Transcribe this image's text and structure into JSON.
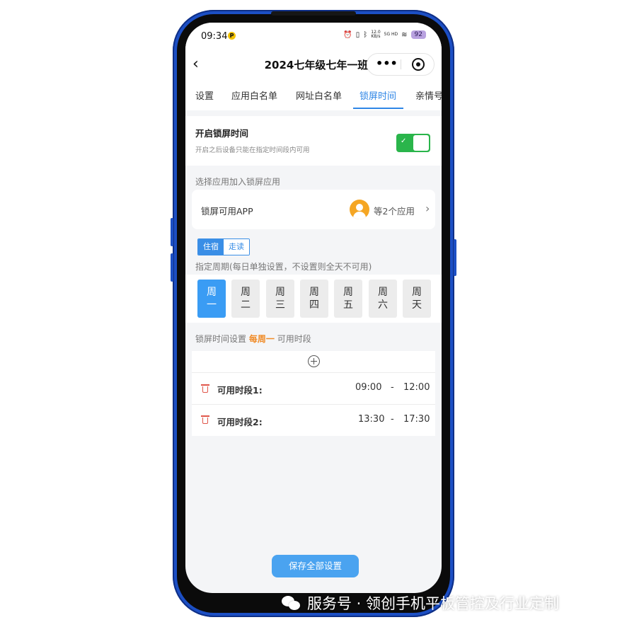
{
  "status_bar": {
    "time": "09:34",
    "badge": "P",
    "net_speed_value": "12.0",
    "net_speed_unit": "KB/s",
    "signal_label": "5G HD",
    "battery": "92"
  },
  "nav": {
    "title": "2024七年级七年一班",
    "more": "•••"
  },
  "tabs": [
    "设置",
    "应用白名单",
    "网址白名单",
    "锁屏时间",
    "亲情号"
  ],
  "lock": {
    "title": "开启锁屏时间",
    "description": "开启之后设备只能在指定时间段内可用",
    "enabled": true
  },
  "app_section": {
    "label": "选择应用加入锁屏应用",
    "card_label": "锁屏可用APP",
    "count": "等2个应用"
  },
  "mode": {
    "options": [
      "住宿",
      "走读"
    ],
    "selected": "住宿"
  },
  "week": {
    "label": "指定周期(每日单独设置，不设置则全天不可用)",
    "days": [
      {
        "top": "周",
        "bottom": "一",
        "active": true
      },
      {
        "top": "周",
        "bottom": "二",
        "active": false
      },
      {
        "top": "周",
        "bottom": "三",
        "active": false
      },
      {
        "top": "周",
        "bottom": "四",
        "active": false
      },
      {
        "top": "周",
        "bottom": "五",
        "active": false
      },
      {
        "top": "周",
        "bottom": "六",
        "active": false
      },
      {
        "top": "周",
        "bottom": "天",
        "active": false
      }
    ]
  },
  "schedule": {
    "label_prefix": "锁屏时间设置",
    "label_day": "每周一",
    "label_suffix": "可用时段",
    "periods": [
      {
        "label": "可用时段1:",
        "start": "09:00",
        "sep": "-",
        "end": "12:00"
      },
      {
        "label": "可用时段2:",
        "start": "13:30",
        "sep": "-",
        "end": "17:30"
      }
    ]
  },
  "save_label": "保存全部设置",
  "watermark": "服务号 · 领创手机平板管控及行业定制",
  "colors": {
    "phone_frame": "#1c4fc4",
    "accent_blue": "#2f86e6",
    "toggle_green": "#2ab54b",
    "highlight_orange": "#f08b27",
    "trash_red": "#e0564a"
  }
}
